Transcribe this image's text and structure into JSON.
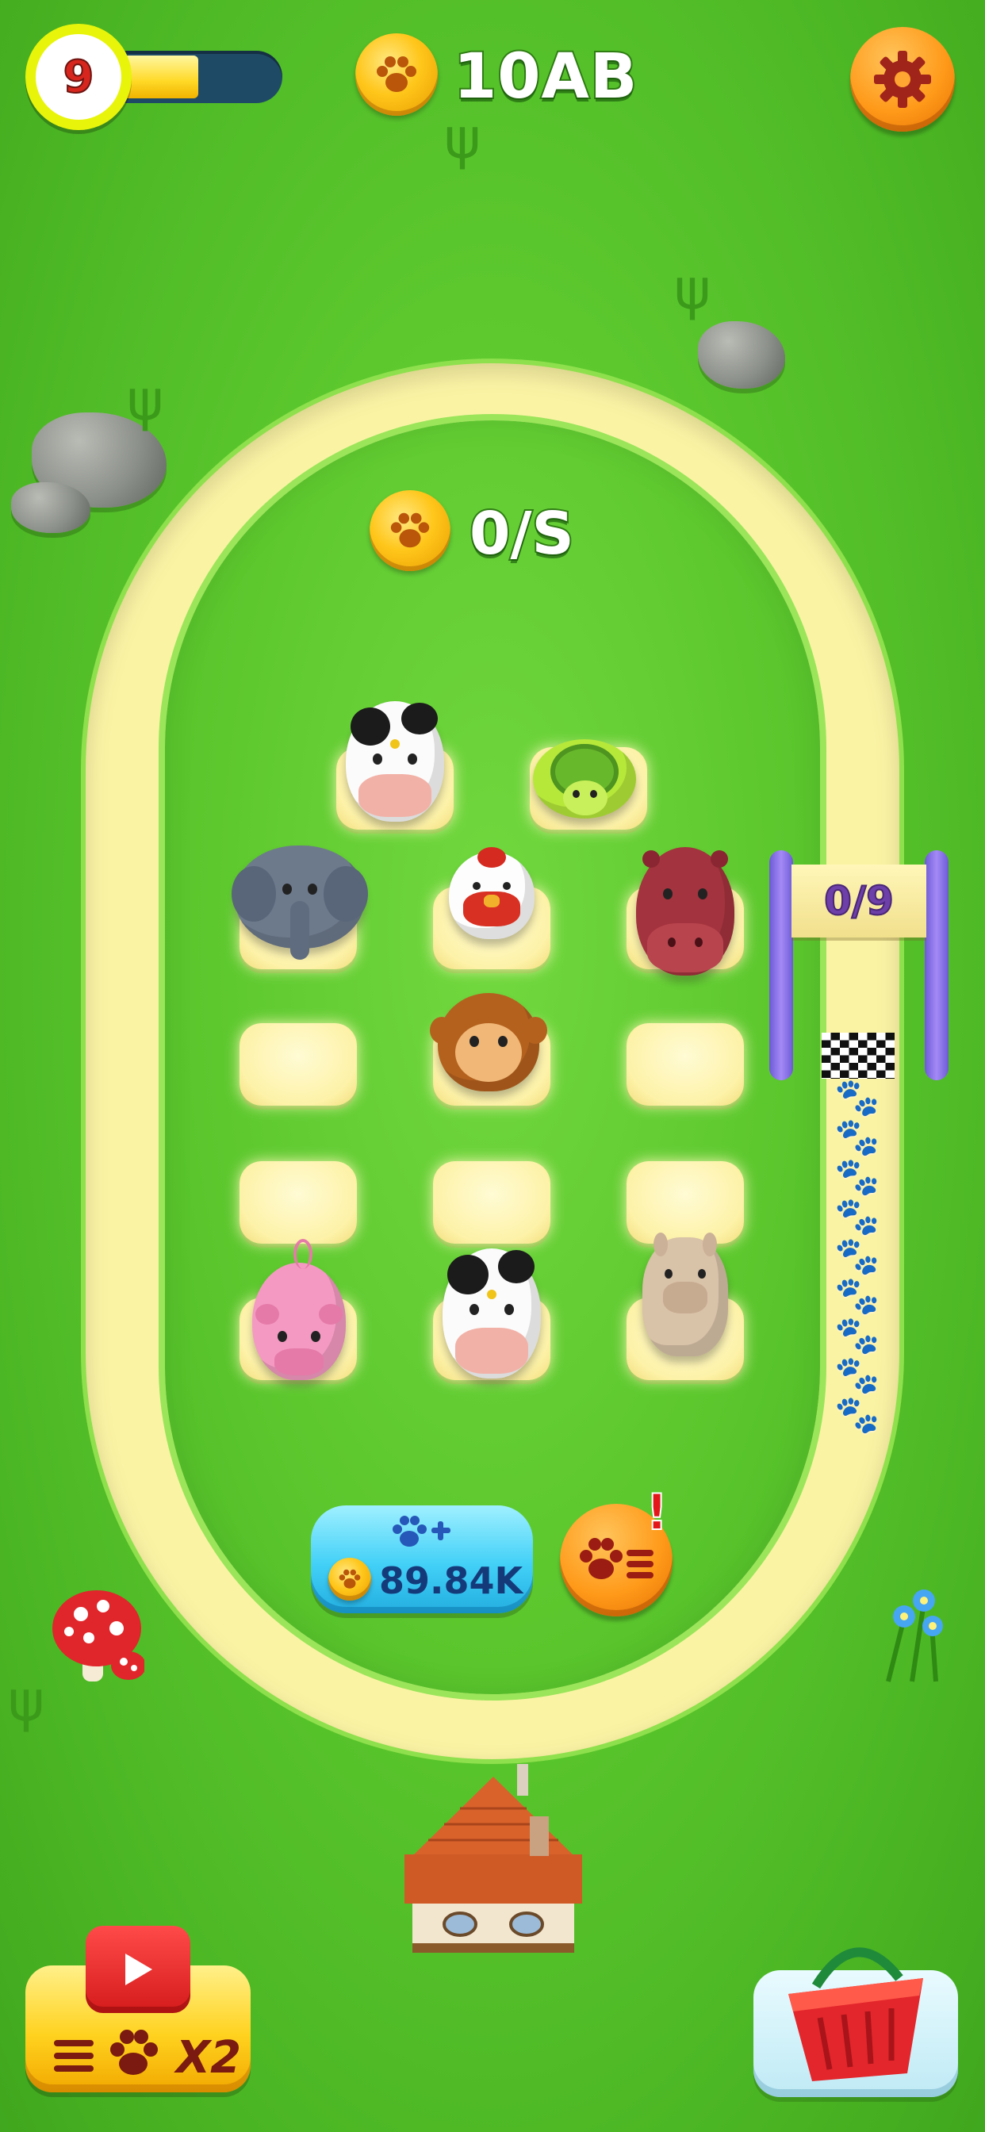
{
  "hud": {
    "level": "9",
    "level_progress": 0.55,
    "currency": "10AB",
    "settings_icon": "gear-icon"
  },
  "field": {
    "income_rate": "0/S"
  },
  "race": {
    "counter": "0/9"
  },
  "buy_button": {
    "price": "89.84K",
    "icon": "paw-plus-icon"
  },
  "list_button": {
    "icon": "paw-list-icon",
    "alert": "!"
  },
  "boost_button": {
    "label": "X2",
    "icon": "play-video-icon"
  },
  "shop_button": {
    "icon": "basket-icon"
  },
  "slots": [
    {
      "animal": "cow"
    },
    {
      "animal": "turtle"
    },
    {
      "animal": "elephant"
    },
    {
      "animal": "chicken"
    },
    {
      "animal": "hippo"
    },
    {
      "animal": ""
    },
    {
      "animal": "monkey"
    },
    {
      "animal": ""
    },
    {
      "animal": ""
    },
    {
      "animal": ""
    },
    {
      "animal": ""
    },
    {
      "animal": "pig"
    },
    {
      "animal": "cow"
    },
    {
      "animal": "llama"
    }
  ],
  "colors": {
    "grass": "#5cc82e",
    "track": "#fbf3a4",
    "coin": "#ffc61a",
    "button_blue": "#42d0f7",
    "button_orange": "#ff9a1a"
  }
}
